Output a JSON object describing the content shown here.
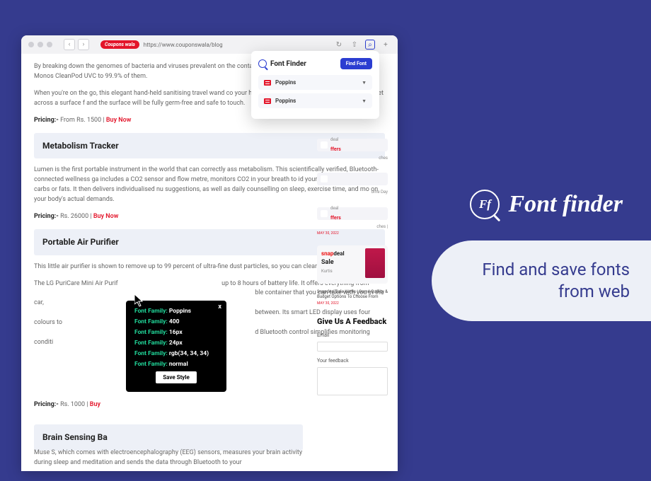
{
  "browser": {
    "badge": "Coupons wala",
    "url": "https://www.couponswala/blog"
  },
  "article": {
    "p1": "By breaking down the genomes of bacteria and viruses prevalent on the contact every day, the UV-C light released by the Monos CleanPod UVC to 99.9% of them.",
    "p2": "When you're on the go, this elegant hand-held sanitising travel wand co your handbag or backpack. Simply sweep the gadget across a surface f and the surface will be fully germ-free and safe to touch.",
    "price_lbl": "Pricing:-",
    "price1": "From Rs. 1500 | ",
    "buy": "Buy Now",
    "h1": "Metabolism Tracker",
    "p3": "Lumen is the first portable instrument in the world that can correctly ass metabolism. This scientifically verified, Bluetooth-connected wellness ga includes a CO2 sensor and flow metre, monitors CO2 in your breath to id your body's fuel source is carbs or fats. It then delivers individualised nu suggestions, as well as daily counselling on sleep, exercise time, and mo on your body's actual demands.",
    "price2": "Rs. 26000 | ",
    "h2": "Portable Air Purifier",
    "p4": "This little air purifier is shown to remove up to 99 percent of ultra-fine dust particles, so you can clean your air on",
    "p5_a": "The LG PuriCare Mini Air Purif",
    "p5_b": "up to 8 hours of battery life. It offers everything from",
    "p5_c": "ble container that you can take with you in the car,",
    "p5_d": "between. Its smart LED display uses four colours to",
    "p5_e": "d Bluetooth control simplifies monitoring conditi",
    "price3": "Rs. 1000 | ",
    "buy3": "Buy",
    "h3": "Brain Sensing Ba",
    "p6": "Muse S, which comes with electroencephalography (EEG) sensors, measures your brain activity during sleep and meditation and sends the data through Bluetooth to your"
  },
  "sidebar": {
    "deal": "deal",
    "offers": "ffers",
    "small1": "ches",
    "small2": "ome Day",
    "small3": "ches | ",
    "date1": "MAY 30, 2022",
    "snap_s": "snap",
    "snap_d": "deal",
    "sale": "Sale",
    "kurt": "Kurtis",
    "cap": "Snapdeal Sale Kurtis | Some Quality & Budget Options To Choose From",
    "date2": "MAY 30, 2022",
    "fb_title": "Give Us A Feedback",
    "email": "Email",
    "feedback": "Your feedback"
  },
  "popup": {
    "title": "Font Finder",
    "btn": "Find Font",
    "font": "Poppins"
  },
  "tooltip": {
    "key": "Font Family:",
    "v1": "Poppins",
    "v2": "400",
    "v3": "16px",
    "v4": "24px",
    "v5": "rgb(34, 34, 34)",
    "v6": "normal",
    "btn": "Save Style"
  },
  "brand": {
    "ff": "Ff",
    "name": "Font finder",
    "tagline": "Find and save fonts from web"
  }
}
